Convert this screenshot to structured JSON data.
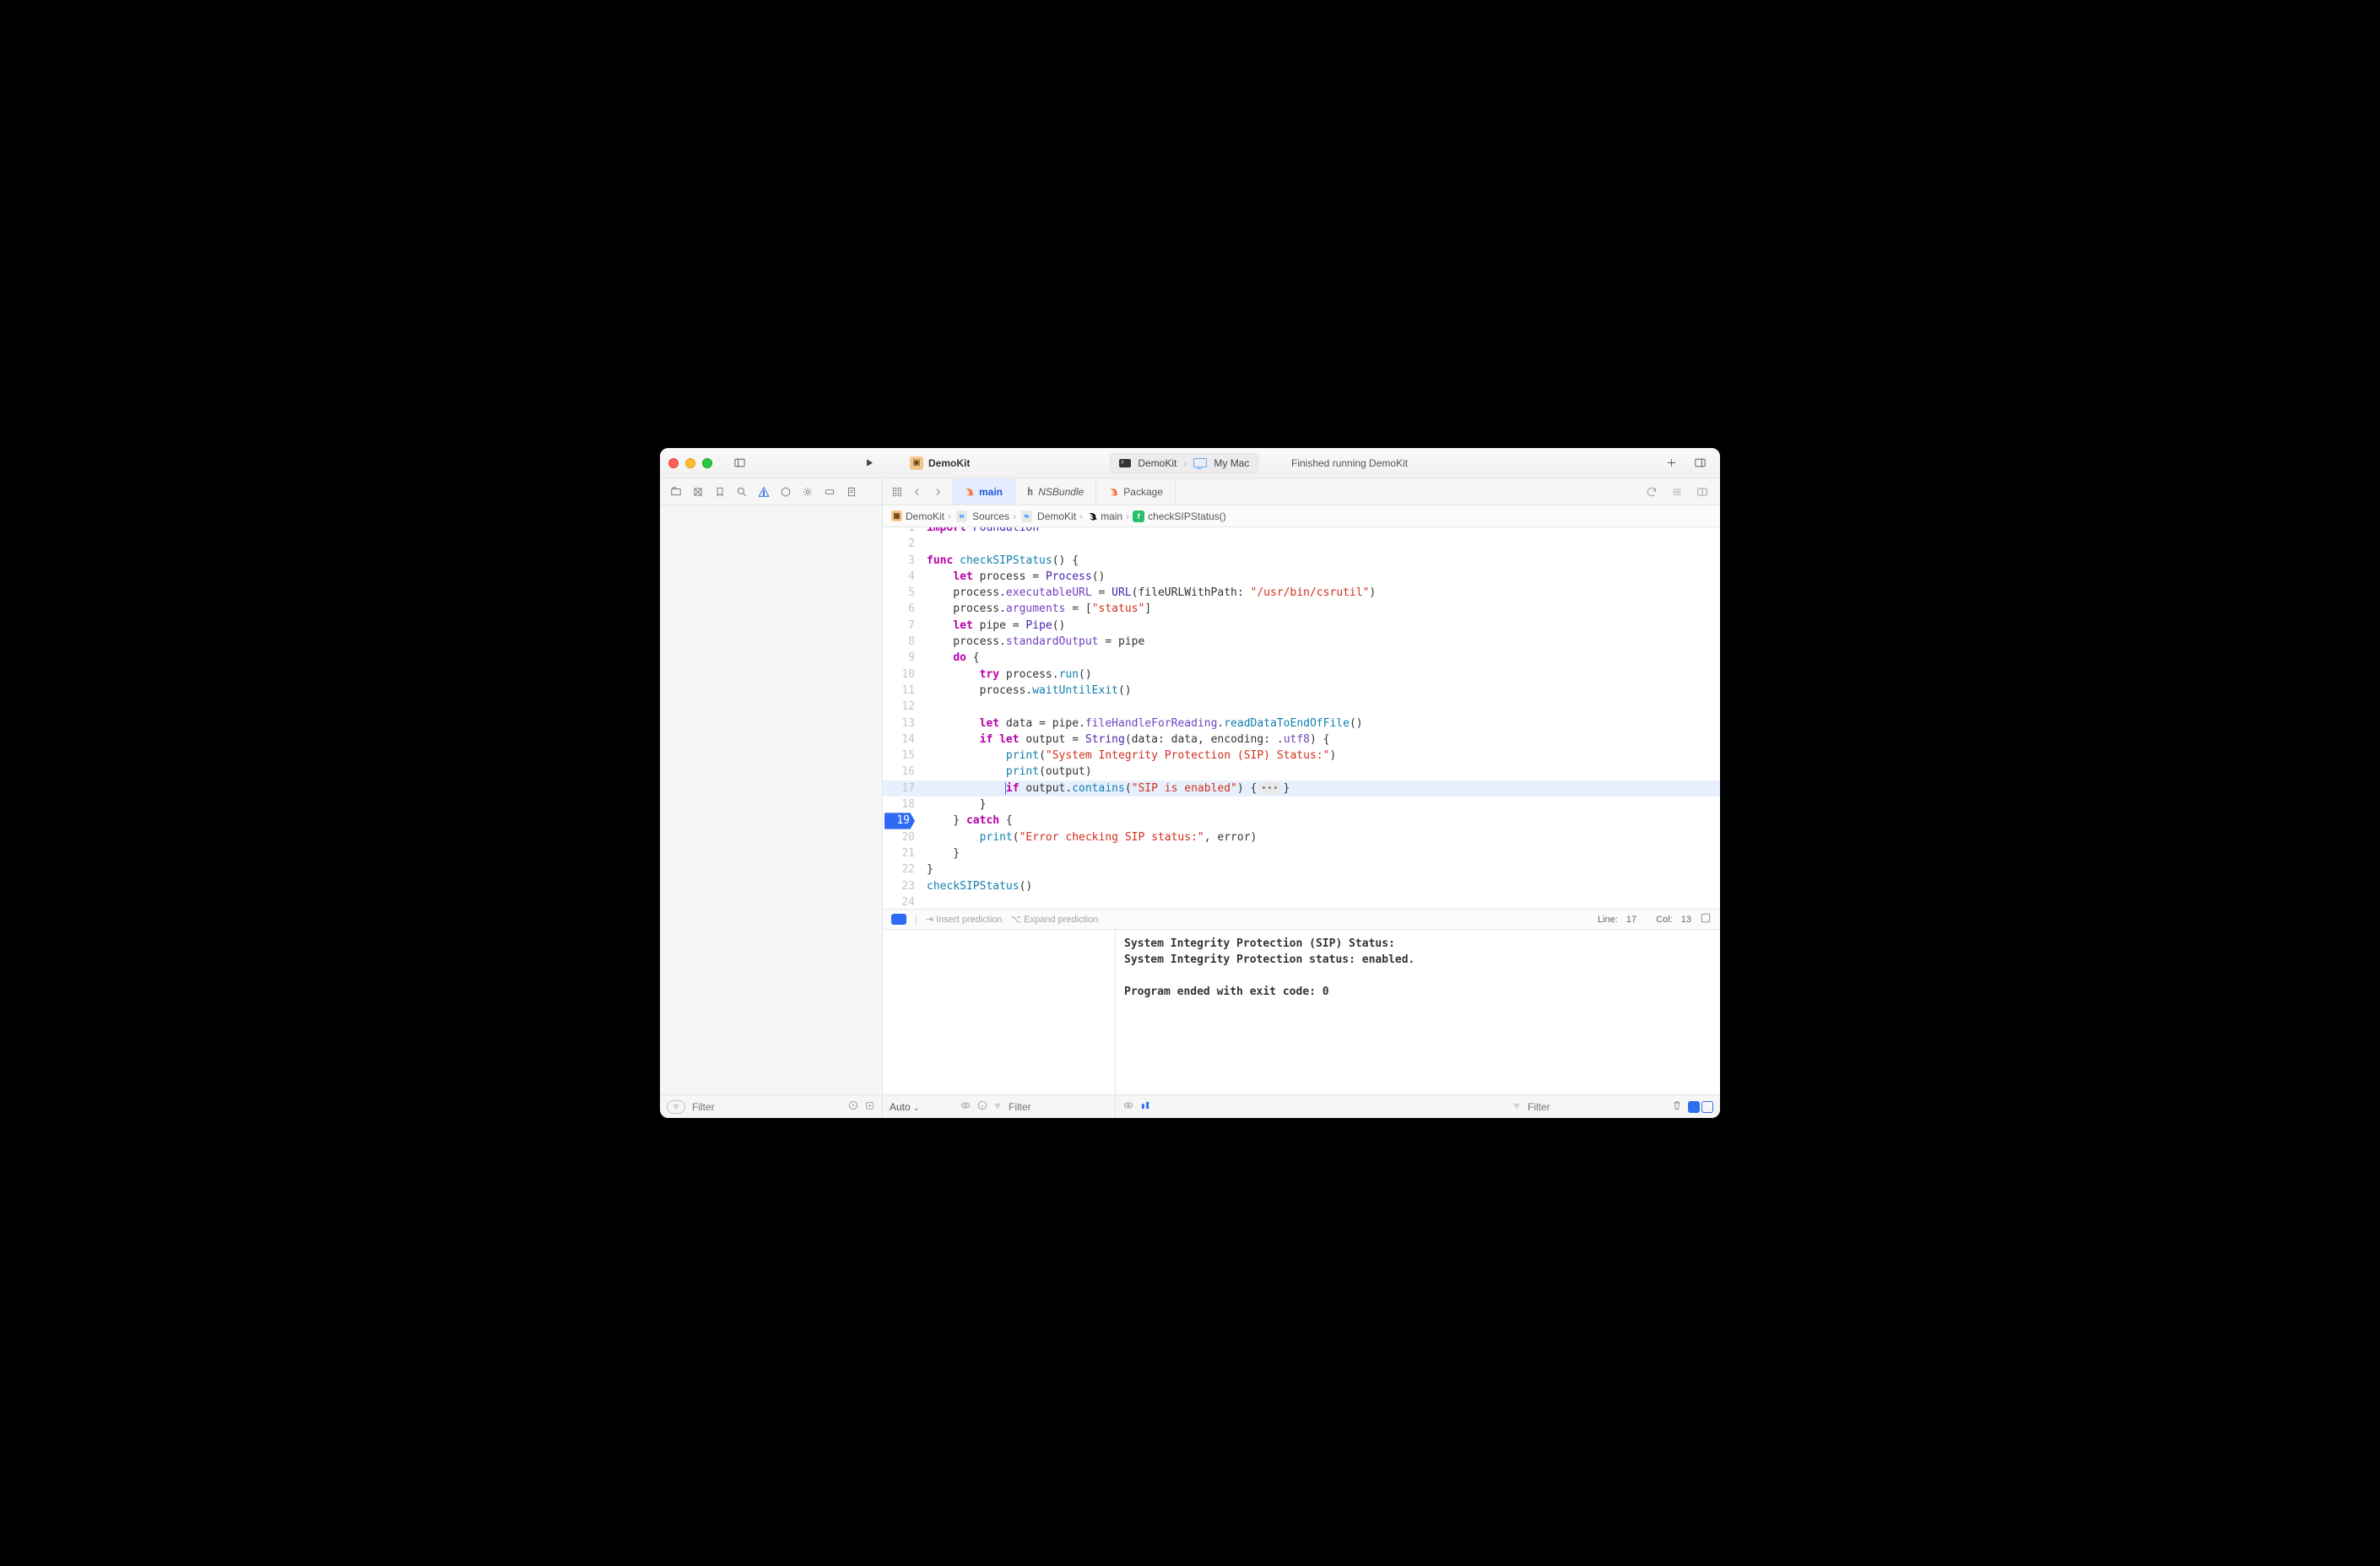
{
  "titlebar": {
    "project_name": "DemoKit",
    "scheme_name": "DemoKit",
    "run_destination": "My Mac",
    "status_message": "Finished running DemoKit"
  },
  "editor_tabs": [
    {
      "label": "main",
      "icon": "swift",
      "active": true,
      "italic": false
    },
    {
      "label": "NSBundle",
      "icon": "h",
      "active": false,
      "italic": true
    },
    {
      "label": "Package",
      "icon": "swift",
      "active": false,
      "italic": false
    }
  ],
  "breadcrumb": [
    {
      "label": "DemoKit",
      "icon": "pkg"
    },
    {
      "label": "Sources",
      "icon": "folder"
    },
    {
      "label": "DemoKit",
      "icon": "folder"
    },
    {
      "label": "main",
      "icon": "swift"
    },
    {
      "label": "checkSIPStatus()",
      "icon": "fn"
    }
  ],
  "code": {
    "first_visible_line": 1,
    "breakpoint_line": 19,
    "highlighted_line": 17,
    "cursor": {
      "line": 17,
      "col": 13
    },
    "lines": [
      {
        "n": 1,
        "partial": true,
        "tokens": [
          {
            "t": "import",
            "c": "kw"
          },
          {
            "t": " "
          },
          {
            "t": "Foundation",
            "c": "ty"
          }
        ]
      },
      {
        "n": 2,
        "tokens": []
      },
      {
        "n": 3,
        "tokens": [
          {
            "t": "func ",
            "c": "kw"
          },
          {
            "t": "checkSIPStatus",
            "c": "df"
          },
          {
            "t": "() {"
          }
        ]
      },
      {
        "n": 4,
        "tokens": [
          {
            "t": "    "
          },
          {
            "t": "let",
            "c": "kw"
          },
          {
            "t": " process = "
          },
          {
            "t": "Process",
            "c": "ty"
          },
          {
            "t": "()"
          }
        ]
      },
      {
        "n": 5,
        "tokens": [
          {
            "t": "    process."
          },
          {
            "t": "executableURL",
            "c": "mb"
          },
          {
            "t": " = "
          },
          {
            "t": "URL",
            "c": "ty"
          },
          {
            "t": "(fileURLWithPath: "
          },
          {
            "t": "\"/usr/bin/csrutil\"",
            "c": "st"
          },
          {
            "t": ")"
          }
        ]
      },
      {
        "n": 6,
        "tokens": [
          {
            "t": "    process."
          },
          {
            "t": "arguments",
            "c": "mb"
          },
          {
            "t": " = ["
          },
          {
            "t": "\"status\"",
            "c": "st"
          },
          {
            "t": "]"
          }
        ]
      },
      {
        "n": 7,
        "tokens": [
          {
            "t": "    "
          },
          {
            "t": "let",
            "c": "kw"
          },
          {
            "t": " pipe = "
          },
          {
            "t": "Pipe",
            "c": "ty"
          },
          {
            "t": "()"
          }
        ]
      },
      {
        "n": 8,
        "tokens": [
          {
            "t": "    process."
          },
          {
            "t": "standardOutput",
            "c": "mb"
          },
          {
            "t": " = pipe"
          }
        ]
      },
      {
        "n": 9,
        "tokens": [
          {
            "t": "    "
          },
          {
            "t": "do",
            "c": "kw"
          },
          {
            "t": " {"
          }
        ]
      },
      {
        "n": 10,
        "tokens": [
          {
            "t": "        "
          },
          {
            "t": "try",
            "c": "kw"
          },
          {
            "t": " process."
          },
          {
            "t": "run",
            "c": "df"
          },
          {
            "t": "()"
          }
        ]
      },
      {
        "n": 11,
        "tokens": [
          {
            "t": "        process."
          },
          {
            "t": "waitUntilExit",
            "c": "df"
          },
          {
            "t": "()"
          }
        ]
      },
      {
        "n": 12,
        "tokens": []
      },
      {
        "n": 13,
        "tokens": [
          {
            "t": "        "
          },
          {
            "t": "let",
            "c": "kw"
          },
          {
            "t": " data = pipe."
          },
          {
            "t": "fileHandleForReading",
            "c": "mb"
          },
          {
            "t": "."
          },
          {
            "t": "readDataToEndOfFile",
            "c": "df"
          },
          {
            "t": "()"
          }
        ]
      },
      {
        "n": 14,
        "tokens": [
          {
            "t": "        "
          },
          {
            "t": "if",
            "c": "kw"
          },
          {
            "t": " "
          },
          {
            "t": "let",
            "c": "kw"
          },
          {
            "t": " output = "
          },
          {
            "t": "String",
            "c": "ty"
          },
          {
            "t": "(data: data, encoding: ."
          },
          {
            "t": "utf8",
            "c": "mb"
          },
          {
            "t": ") {"
          }
        ]
      },
      {
        "n": 15,
        "tokens": [
          {
            "t": "            "
          },
          {
            "t": "print",
            "c": "df"
          },
          {
            "t": "("
          },
          {
            "t": "\"System Integrity Protection (SIP) Status:\"",
            "c": "st"
          },
          {
            "t": ")"
          }
        ]
      },
      {
        "n": 16,
        "tokens": [
          {
            "t": "            "
          },
          {
            "t": "print",
            "c": "df"
          },
          {
            "t": "(output)"
          }
        ]
      },
      {
        "n": 17,
        "tokens": [
          {
            "t": "            "
          },
          {
            "cursor": true
          },
          {
            "t": "if",
            "c": "kw"
          },
          {
            "t": " output."
          },
          {
            "t": "contains",
            "c": "df"
          },
          {
            "t": "("
          },
          {
            "t": "\"SIP is enabled\"",
            "c": "st"
          },
          {
            "t": ") {"
          },
          {
            "fold": true
          },
          {
            "t": "}"
          }
        ]
      },
      {
        "n": 18,
        "tokens": [
          {
            "t": "        }"
          }
        ]
      },
      {
        "n": 19,
        "tokens": [
          {
            "t": "    } "
          },
          {
            "t": "catch",
            "c": "kw"
          },
          {
            "t": " {"
          }
        ]
      },
      {
        "n": 20,
        "tokens": [
          {
            "t": "        "
          },
          {
            "t": "print",
            "c": "df"
          },
          {
            "t": "("
          },
          {
            "t": "\"Error checking SIP status:\"",
            "c": "st"
          },
          {
            "t": ", error)"
          }
        ]
      },
      {
        "n": 21,
        "tokens": [
          {
            "t": "    }"
          }
        ]
      },
      {
        "n": 22,
        "tokens": [
          {
            "t": "}"
          }
        ]
      },
      {
        "n": 23,
        "tokens": [
          {
            "t": "checkSIPStatus",
            "c": "df"
          },
          {
            "t": "()"
          }
        ]
      },
      {
        "n": 24,
        "partial_bottom": true,
        "tokens": []
      }
    ]
  },
  "prediction_bar": {
    "insert_hint": "⇥ Insert prediction",
    "expand_hint": "⌥ Expand prediction",
    "line_label": "Line:",
    "col_label": "Col:",
    "line_value": "17",
    "col_value": "13"
  },
  "console": {
    "lines": [
      "System Integrity Protection (SIP) Status:",
      "System Integrity Protection status: enabled.",
      "",
      "Program ended with exit code: 0"
    ]
  },
  "bottombar": {
    "auto_label": "Auto",
    "vars_filter_placeholder": "Filter",
    "console_filter_placeholder": "Filter"
  },
  "navigator": {
    "filter_placeholder": "Filter"
  }
}
